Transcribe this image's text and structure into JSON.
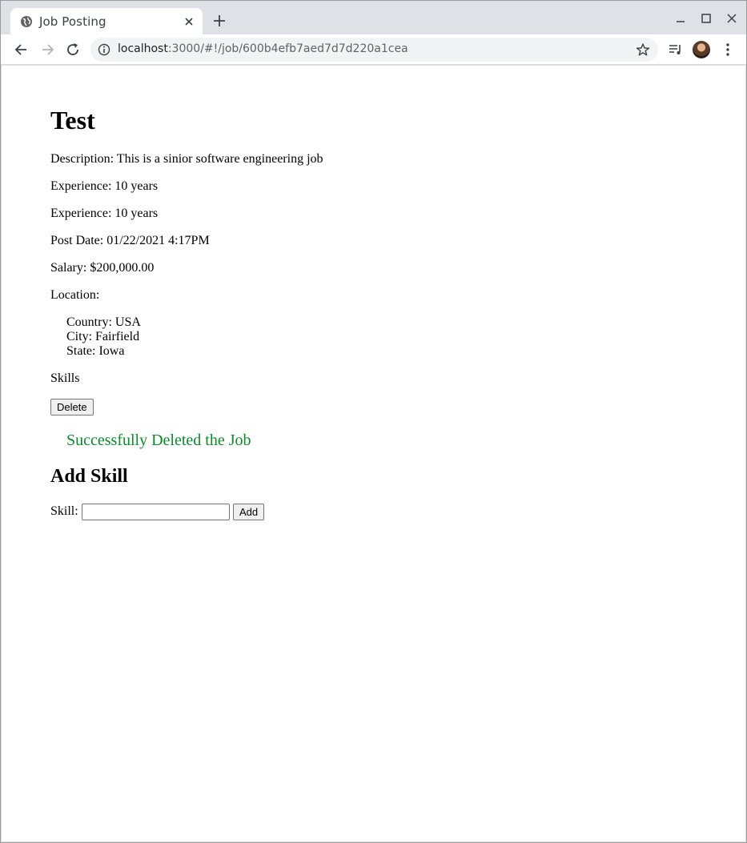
{
  "browser": {
    "tab_title": "Job Posting",
    "url_host": "localhost",
    "url_rest": ":3000/#!/job/600b4efb7aed7d7d220a1cea"
  },
  "job": {
    "title": "Test",
    "description": "Description: This is a sinior software engineering job",
    "experience_1": "Experience: 10 years",
    "experience_2": "Experience: 10 years",
    "post_date": "Post Date: 01/22/2021 4:17PM",
    "salary": "Salary: $200,000.00",
    "location_label": "Location:",
    "location": {
      "country": "Country: USA",
      "city": "City: Fairfield",
      "state": "State: Iowa"
    },
    "skills_label": "Skills",
    "delete_label": "Delete",
    "status_message": "Successfully Deleted the Job"
  },
  "add_skill": {
    "heading": "Add Skill",
    "label": "Skill:",
    "input_value": "",
    "add_label": "Add"
  },
  "colors": {
    "success": "#0b8a2a"
  }
}
